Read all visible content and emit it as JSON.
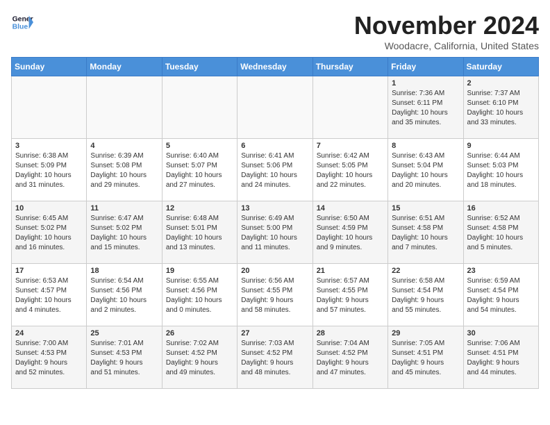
{
  "logo": {
    "line1": "General",
    "line2": "Blue"
  },
  "title": "November 2024",
  "location": "Woodacre, California, United States",
  "weekdays": [
    "Sunday",
    "Monday",
    "Tuesday",
    "Wednesday",
    "Thursday",
    "Friday",
    "Saturday"
  ],
  "weeks": [
    [
      {
        "day": "",
        "info": ""
      },
      {
        "day": "",
        "info": ""
      },
      {
        "day": "",
        "info": ""
      },
      {
        "day": "",
        "info": ""
      },
      {
        "day": "",
        "info": ""
      },
      {
        "day": "1",
        "info": "Sunrise: 7:36 AM\nSunset: 6:11 PM\nDaylight: 10 hours\nand 35 minutes."
      },
      {
        "day": "2",
        "info": "Sunrise: 7:37 AM\nSunset: 6:10 PM\nDaylight: 10 hours\nand 33 minutes."
      }
    ],
    [
      {
        "day": "3",
        "info": "Sunrise: 6:38 AM\nSunset: 5:09 PM\nDaylight: 10 hours\nand 31 minutes."
      },
      {
        "day": "4",
        "info": "Sunrise: 6:39 AM\nSunset: 5:08 PM\nDaylight: 10 hours\nand 29 minutes."
      },
      {
        "day": "5",
        "info": "Sunrise: 6:40 AM\nSunset: 5:07 PM\nDaylight: 10 hours\nand 27 minutes."
      },
      {
        "day": "6",
        "info": "Sunrise: 6:41 AM\nSunset: 5:06 PM\nDaylight: 10 hours\nand 24 minutes."
      },
      {
        "day": "7",
        "info": "Sunrise: 6:42 AM\nSunset: 5:05 PM\nDaylight: 10 hours\nand 22 minutes."
      },
      {
        "day": "8",
        "info": "Sunrise: 6:43 AM\nSunset: 5:04 PM\nDaylight: 10 hours\nand 20 minutes."
      },
      {
        "day": "9",
        "info": "Sunrise: 6:44 AM\nSunset: 5:03 PM\nDaylight: 10 hours\nand 18 minutes."
      }
    ],
    [
      {
        "day": "10",
        "info": "Sunrise: 6:45 AM\nSunset: 5:02 PM\nDaylight: 10 hours\nand 16 minutes."
      },
      {
        "day": "11",
        "info": "Sunrise: 6:47 AM\nSunset: 5:02 PM\nDaylight: 10 hours\nand 15 minutes."
      },
      {
        "day": "12",
        "info": "Sunrise: 6:48 AM\nSunset: 5:01 PM\nDaylight: 10 hours\nand 13 minutes."
      },
      {
        "day": "13",
        "info": "Sunrise: 6:49 AM\nSunset: 5:00 PM\nDaylight: 10 hours\nand 11 minutes."
      },
      {
        "day": "14",
        "info": "Sunrise: 6:50 AM\nSunset: 4:59 PM\nDaylight: 10 hours\nand 9 minutes."
      },
      {
        "day": "15",
        "info": "Sunrise: 6:51 AM\nSunset: 4:58 PM\nDaylight: 10 hours\nand 7 minutes."
      },
      {
        "day": "16",
        "info": "Sunrise: 6:52 AM\nSunset: 4:58 PM\nDaylight: 10 hours\nand 5 minutes."
      }
    ],
    [
      {
        "day": "17",
        "info": "Sunrise: 6:53 AM\nSunset: 4:57 PM\nDaylight: 10 hours\nand 4 minutes."
      },
      {
        "day": "18",
        "info": "Sunrise: 6:54 AM\nSunset: 4:56 PM\nDaylight: 10 hours\nand 2 minutes."
      },
      {
        "day": "19",
        "info": "Sunrise: 6:55 AM\nSunset: 4:56 PM\nDaylight: 10 hours\nand 0 minutes."
      },
      {
        "day": "20",
        "info": "Sunrise: 6:56 AM\nSunset: 4:55 PM\nDaylight: 9 hours\nand 58 minutes."
      },
      {
        "day": "21",
        "info": "Sunrise: 6:57 AM\nSunset: 4:55 PM\nDaylight: 9 hours\nand 57 minutes."
      },
      {
        "day": "22",
        "info": "Sunrise: 6:58 AM\nSunset: 4:54 PM\nDaylight: 9 hours\nand 55 minutes."
      },
      {
        "day": "23",
        "info": "Sunrise: 6:59 AM\nSunset: 4:54 PM\nDaylight: 9 hours\nand 54 minutes."
      }
    ],
    [
      {
        "day": "24",
        "info": "Sunrise: 7:00 AM\nSunset: 4:53 PM\nDaylight: 9 hours\nand 52 minutes."
      },
      {
        "day": "25",
        "info": "Sunrise: 7:01 AM\nSunset: 4:53 PM\nDaylight: 9 hours\nand 51 minutes."
      },
      {
        "day": "26",
        "info": "Sunrise: 7:02 AM\nSunset: 4:52 PM\nDaylight: 9 hours\nand 49 minutes."
      },
      {
        "day": "27",
        "info": "Sunrise: 7:03 AM\nSunset: 4:52 PM\nDaylight: 9 hours\nand 48 minutes."
      },
      {
        "day": "28",
        "info": "Sunrise: 7:04 AM\nSunset: 4:52 PM\nDaylight: 9 hours\nand 47 minutes."
      },
      {
        "day": "29",
        "info": "Sunrise: 7:05 AM\nSunset: 4:51 PM\nDaylight: 9 hours\nand 45 minutes."
      },
      {
        "day": "30",
        "info": "Sunrise: 7:06 AM\nSunset: 4:51 PM\nDaylight: 9 hours\nand 44 minutes."
      }
    ]
  ]
}
